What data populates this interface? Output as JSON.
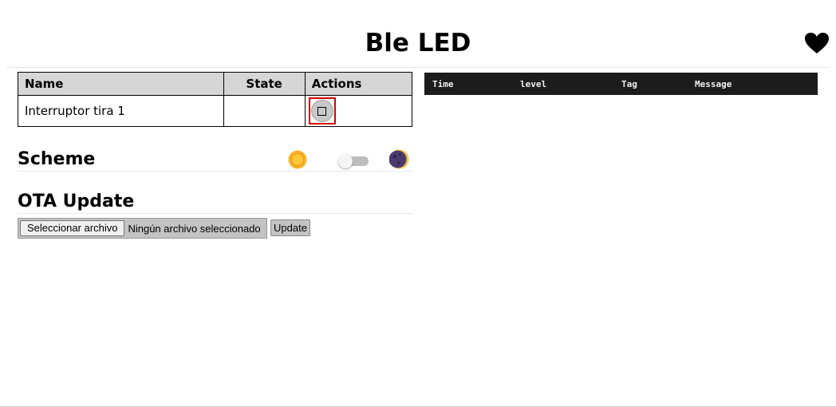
{
  "header": {
    "title": "Ble LED",
    "favorite_icon": "heart-icon"
  },
  "entities": {
    "columns": [
      "Name",
      "State",
      "Actions"
    ],
    "rows": [
      {
        "name": "Interruptor tira 1",
        "state": "",
        "action_icon": "stop-square-icon"
      }
    ]
  },
  "scheme": {
    "title": "Scheme",
    "light_icon": "sun-icon",
    "dark_icon": "moon-icon",
    "dark_enabled": false
  },
  "ota": {
    "title": "OTA Update",
    "file_button_label": "Seleccionar archivo",
    "file_status": "Ningún archivo seleccionado",
    "update_label": "Update"
  },
  "log": {
    "columns": [
      "Time",
      "level",
      "Tag",
      "Message"
    ]
  },
  "colors": {
    "log_header_bg": "#1c1c1c",
    "table_header_bg": "#d6d6d6",
    "highlight_border": "#d40000"
  }
}
